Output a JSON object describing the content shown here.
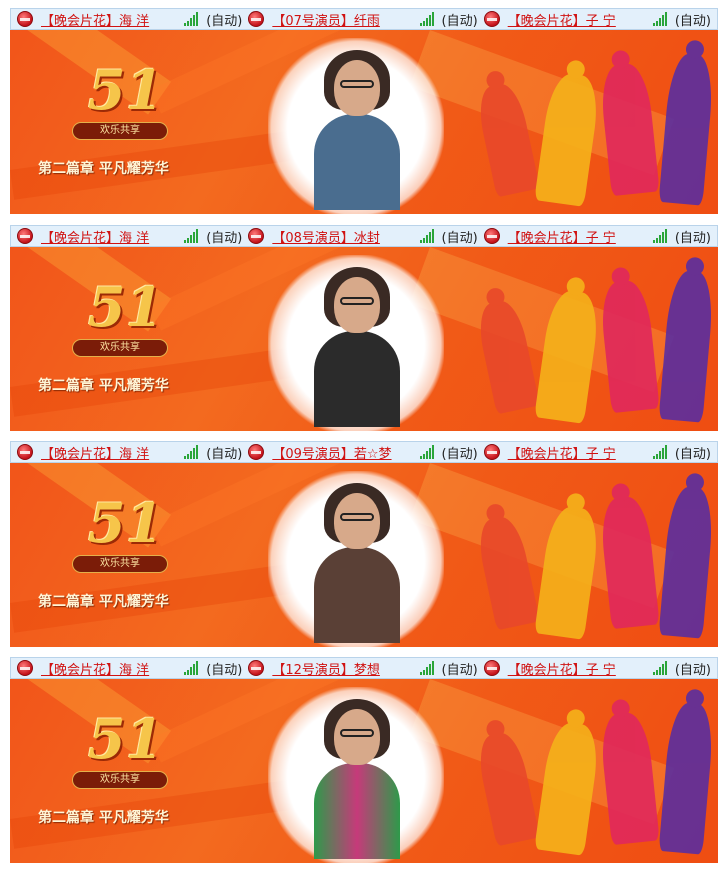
{
  "panels": [
    {
      "left": {
        "name": "【晚会片花】海 洋",
        "mode": "(自动)"
      },
      "center": {
        "name": "【07号演员】纤雨",
        "mode": "(自动)"
      },
      "right": {
        "name": "【晚会片花】子 宁",
        "mode": "(自动)"
      },
      "person": {
        "top": "#4a6d8f",
        "bottom": "#2a3f58"
      }
    },
    {
      "left": {
        "name": "【晚会片花】海 洋",
        "mode": "(自动)"
      },
      "center": {
        "name": "【08号演员】冰封",
        "mode": "(自动)"
      },
      "right": {
        "name": "【晚会片花】子 宁",
        "mode": "(自动)"
      },
      "person": {
        "top": "#2b2b2b",
        "bottom": "#111111"
      }
    },
    {
      "left": {
        "name": "【晚会片花】海 洋",
        "mode": "(自动)"
      },
      "center": {
        "name": "【09号演员】若☆梦",
        "mode": "(自动)"
      },
      "right": {
        "name": "【晚会片花】子 宁",
        "mode": "(自动)"
      },
      "person": {
        "top": "#5a4036",
        "bottom": "#3a2a24"
      }
    },
    {
      "left": {
        "name": "【晚会片花】海 洋",
        "mode": "(自动)"
      },
      "center": {
        "name": "【12号演员】梦想",
        "mode": "(自动)"
      },
      "right": {
        "name": "【晚会片花】子 宁",
        "mode": "(自动)"
      },
      "person": {
        "top": "#2e9a4a",
        "bottom": "#c63a7a"
      }
    }
  ],
  "banner": {
    "badge_number": "51",
    "badge_ribbon": "欢乐共享",
    "subtitle": "第二篇章 平凡耀芳华"
  },
  "colors": {
    "link": "#d01212",
    "header_bg": "#e3f0fb",
    "signal": "#2aa53a",
    "stage": "#f15a17"
  },
  "icons": {
    "channel_logo": "red-globe-logo-icon",
    "signal": "signal-strength-icon"
  }
}
